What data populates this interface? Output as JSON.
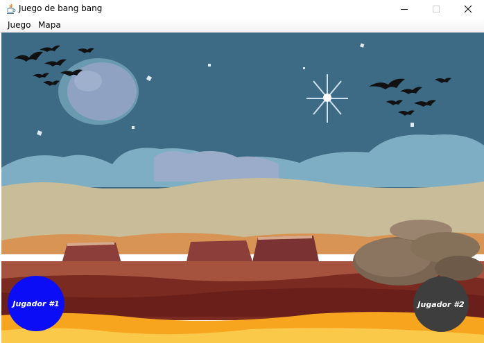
{
  "window": {
    "title": "Juego de bang bang"
  },
  "menu": {
    "items": [
      "Juego",
      "Mapa"
    ]
  },
  "players": {
    "p1": {
      "label": "Jugador #1",
      "color": "#0a0df5"
    },
    "p2": {
      "label": "Jugador #2",
      "color": "#3e3e3e"
    }
  },
  "colors": {
    "sky": "#3d6b85",
    "moon": "#8fa2c2",
    "sand": "#c8bd98",
    "lava": "#f7a51e"
  },
  "icons": {
    "app": "java-coffee-icon",
    "minimize": "minimize-icon",
    "maximize": "maximize-icon",
    "close": "close-icon"
  }
}
